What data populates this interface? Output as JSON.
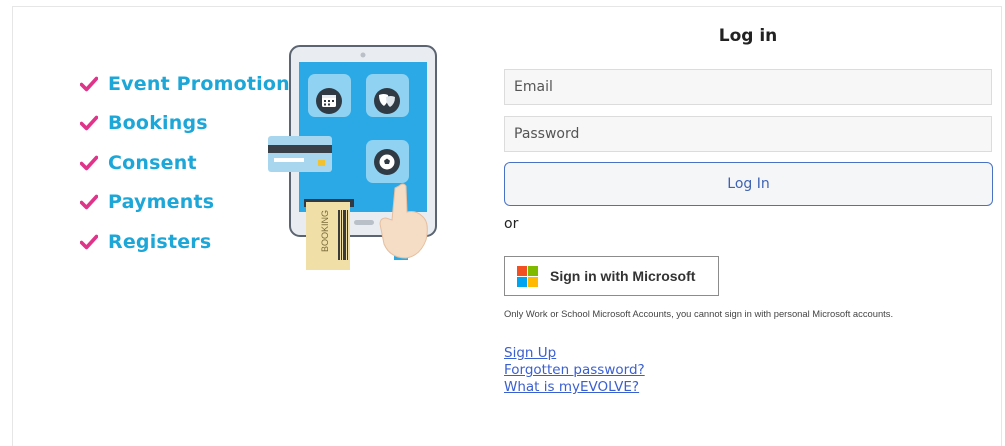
{
  "features": [
    "Event Promotion",
    "Bookings",
    "Consent",
    "Payments",
    "Registers"
  ],
  "illustration": {
    "ticket_label": "BOOKING",
    "icons": [
      "calendar-icon",
      "theatre-masks-icon",
      "football-icon"
    ]
  },
  "login": {
    "title": "Log in",
    "email_placeholder": "Email",
    "password_placeholder": "Password",
    "login_button": "Log In",
    "or_text": "or",
    "microsoft_button": "Sign in with Microsoft",
    "microsoft_note": "Only Work or School Microsoft Accounts, you cannot sign in with personal Microsoft accounts.",
    "links": {
      "sign_up": "Sign Up",
      "forgotten_password": "Forgotten password?",
      "what_is": "What is myEVOLVE?"
    }
  },
  "colors": {
    "feature_text": "#1da6d8",
    "check": "#e0338a",
    "link": "#3a5fd0",
    "button_border": "#4a72c4",
    "ms_red": "#f25022",
    "ms_green": "#7fba00",
    "ms_blue": "#00a4ef",
    "ms_yellow": "#ffb900"
  }
}
